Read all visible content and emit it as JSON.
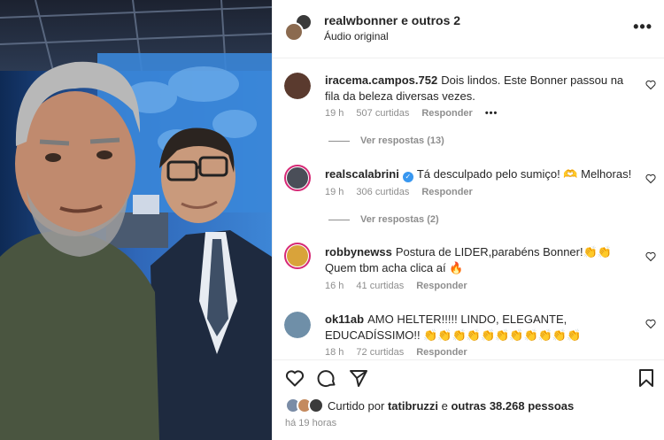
{
  "post": {
    "author": "realwbonner e outros 2",
    "audio": "Áudio original",
    "more": "•••"
  },
  "comments": [
    {
      "user": "iracema.campos.752",
      "text": "Dois lindos. Este Bonner passou na fila da beleza diversas vezes.",
      "time": "19 h",
      "likes": "507 curtidas",
      "reply": "Responder",
      "options": "•••",
      "view_replies": "Ver respostas (13)"
    },
    {
      "user": "realscalabrini",
      "verified": "✓",
      "text": "Tá desculpado pelo sumiço! 🫶 Melhoras!",
      "time": "19 h",
      "likes": "306 curtidas",
      "reply": "Responder",
      "view_replies": "Ver respostas (2)"
    },
    {
      "user": "robbynewss",
      "text": "Postura de LIDER,parabéns Bonner!👏👏 Quem tbm acha clica aí 🔥",
      "time": "16 h",
      "likes": "41 curtidas",
      "reply": "Responder"
    },
    {
      "user": "ok11ab",
      "text": "AMO HELTER!!!!! LINDO, ELEGANTE, EDUCADÍSSIMO!! 👏👏👏👏👏👏👏👏👏👏👏",
      "time": "18 h",
      "likes": "72 curtidas",
      "reply": "Responder"
    }
  ],
  "likes": {
    "prefix": "Curtido por",
    "user": "tatibruzzi",
    "middle": "e",
    "others": "outras 38.268 pessoas"
  },
  "time_ago": "há 19 horas",
  "icons": {
    "like": "heart-icon",
    "comment": "comment-icon",
    "share": "paper-plane-icon",
    "save": "bookmark-icon"
  },
  "colors": {
    "text": "#262626",
    "secondary": "#8e8e8e",
    "verified": "#3897f0",
    "story_ring": "#d62976"
  }
}
